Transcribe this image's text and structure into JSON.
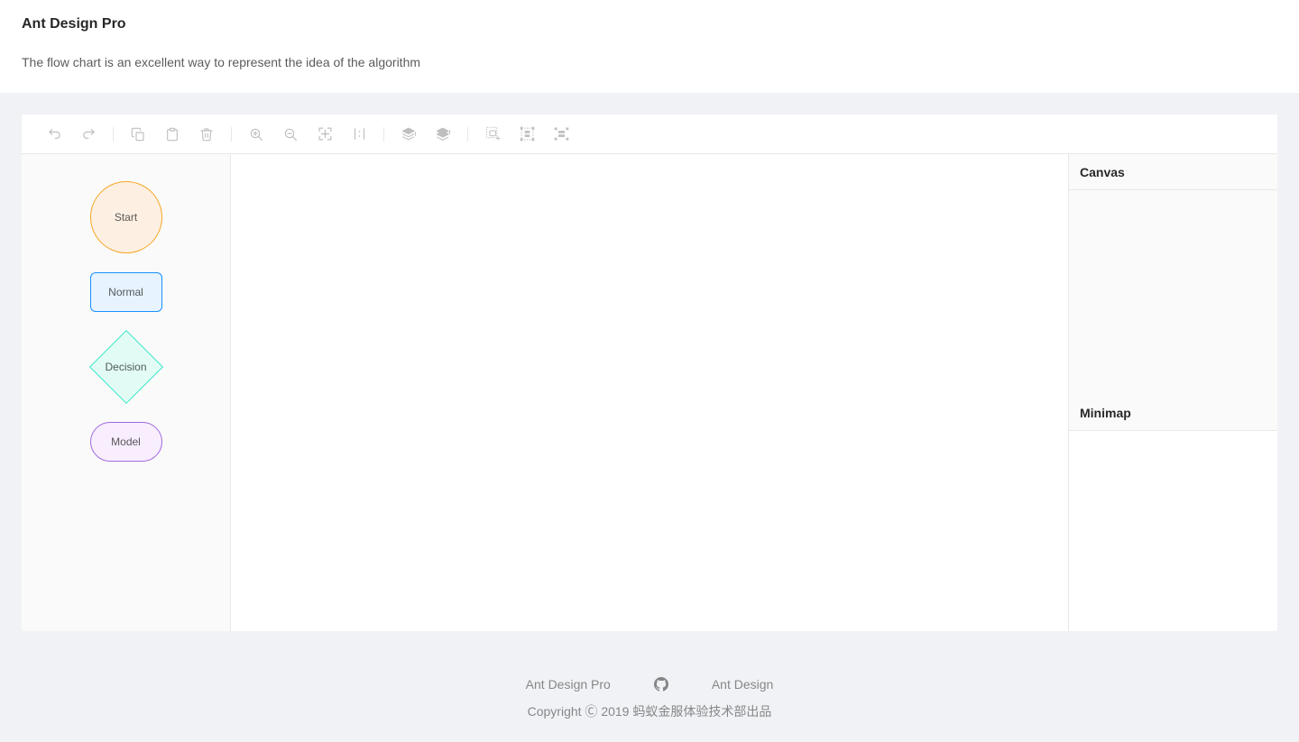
{
  "header": {
    "title": "Ant Design Pro",
    "description": "The flow chart is an excellent way to represent the idea of the algorithm"
  },
  "toolbar": {
    "items": [
      {
        "name": "undo-icon",
        "label": "Undo",
        "group": 1
      },
      {
        "name": "redo-icon",
        "label": "Redo",
        "group": 1
      },
      {
        "name": "copy-icon",
        "label": "Copy",
        "group": 2
      },
      {
        "name": "paste-icon",
        "label": "Paste",
        "group": 2
      },
      {
        "name": "delete-icon",
        "label": "Delete",
        "group": 2
      },
      {
        "name": "zoom-in-icon",
        "label": "Zoom In",
        "group": 3
      },
      {
        "name": "zoom-out-icon",
        "label": "Zoom Out",
        "group": 3
      },
      {
        "name": "fit-to-screen-icon",
        "label": "Fit to Screen",
        "group": 3
      },
      {
        "name": "actual-size-icon",
        "label": "Actual Size",
        "group": 3
      },
      {
        "name": "bring-to-front-icon",
        "label": "Bring to Front",
        "group": 4
      },
      {
        "name": "send-to-back-icon",
        "label": "Send to Back",
        "group": 4
      },
      {
        "name": "group-icon",
        "label": "Group",
        "group": 5
      },
      {
        "name": "ungroup-icon",
        "label": "Ungroup",
        "group": 5
      },
      {
        "name": "multi-select-icon",
        "label": "Multi Select",
        "group": 5
      }
    ]
  },
  "palette": {
    "shapes": [
      {
        "label": "Start",
        "type": "circle",
        "fill": "#FDF0E3",
        "stroke": "#F5A623"
      },
      {
        "label": "Normal",
        "type": "rect",
        "fill": "#E7F3FE",
        "stroke": "#1890FF"
      },
      {
        "label": "Decision",
        "type": "diamond",
        "fill": "#E2FBF5",
        "stroke": "#3BE8C7"
      },
      {
        "label": "Model",
        "type": "pill",
        "fill": "#F8EEFD",
        "stroke": "#A069DE"
      }
    ]
  },
  "panels": {
    "canvas_title": "Canvas",
    "minimap_title": "Minimap"
  },
  "footer": {
    "links": [
      {
        "label": "Ant Design Pro"
      },
      {
        "label": "Ant Design"
      }
    ],
    "github_icon": "github-icon",
    "copyright": "Copyright Ⓒ 2019 蚂蚁金服体验技术部出品"
  },
  "colors": {
    "page_background": "#F0F2F5",
    "card_background": "#FFFFFF",
    "border": "#E8E8E8",
    "panel_background": "#FAFAFA",
    "icon": "#BFBFBF",
    "text_primary": "rgba(0,0,0,0.85)",
    "text_secondary": "rgba(0,0,0,0.65)",
    "text_tertiary": "rgba(0,0,0,0.45)"
  }
}
